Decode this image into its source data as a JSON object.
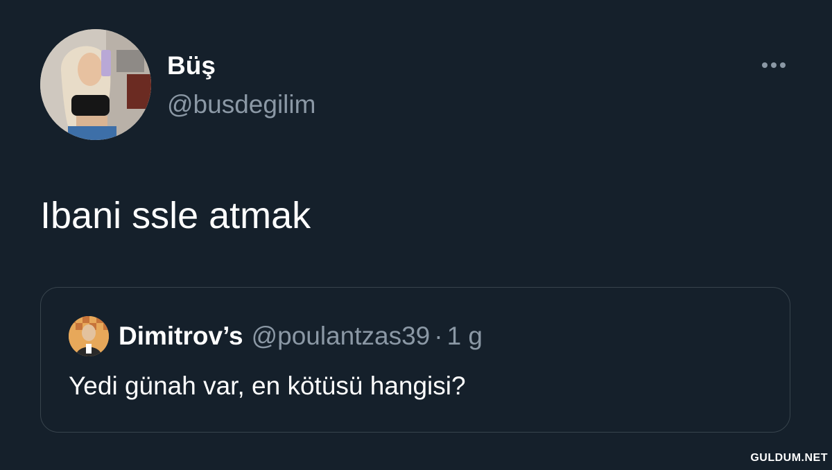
{
  "author": {
    "display_name": "Büş",
    "handle": "@busdegilim",
    "avatar_icon": "profile-photo-avatar"
  },
  "more_icon": "ellipsis-icon",
  "tweet": {
    "text": "Ibani ssle atmak"
  },
  "quoted_tweet": {
    "display_name": "Dimitrov’s",
    "handle": "@poulantzas39",
    "separator": "·",
    "time": "1 g",
    "text": "Yedi günah var, en kötüsü hangisi?"
  },
  "watermark": "GULDUM.NET",
  "colors": {
    "background": "#15202b",
    "secondary_text": "#8b98a5",
    "border": "#38444d",
    "primary_text": "#ffffff"
  }
}
